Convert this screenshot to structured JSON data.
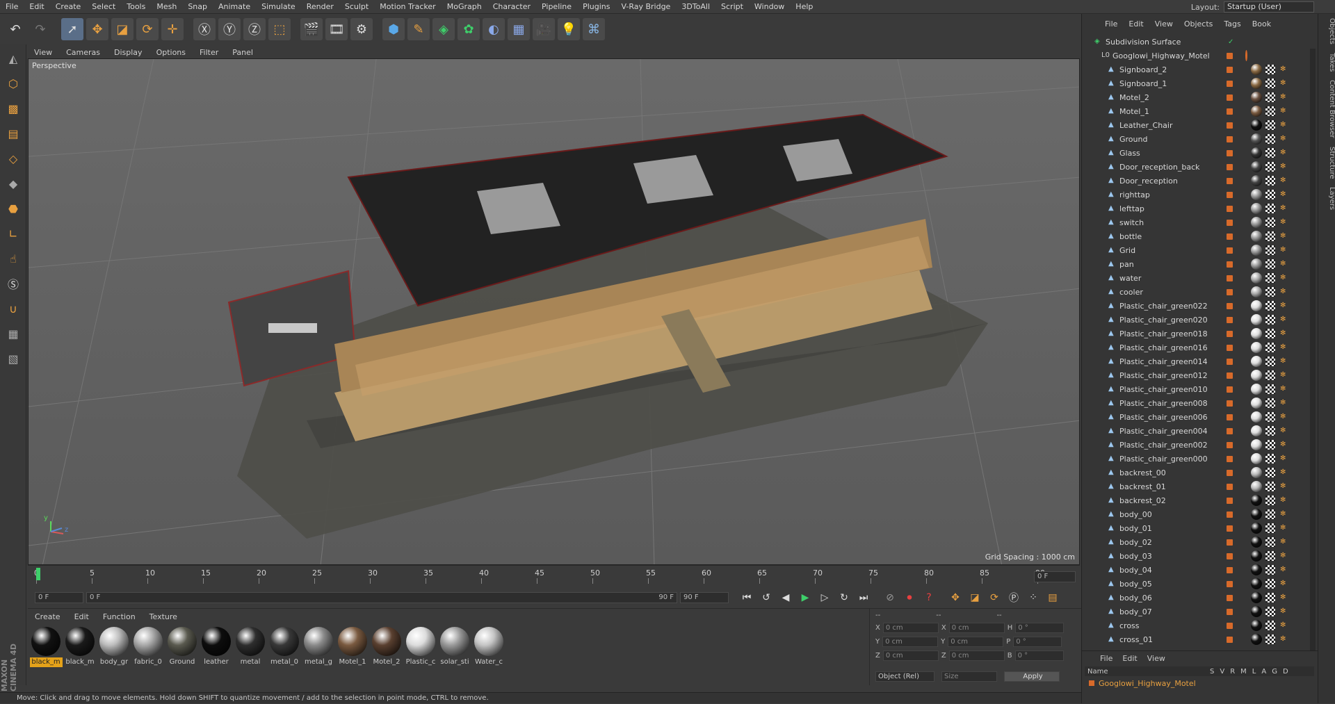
{
  "menubar": {
    "items": [
      "File",
      "Edit",
      "Create",
      "Select",
      "Tools",
      "Mesh",
      "Snap",
      "Animate",
      "Simulate",
      "Render",
      "Sculpt",
      "Motion Tracker",
      "MoGraph",
      "Character",
      "Pipeline",
      "Plugins",
      "V-Ray Bridge",
      "3DToAll",
      "Script",
      "Window",
      "Help"
    ],
    "layout_label": "Layout:",
    "layout_value": "Startup (User)"
  },
  "viewport": {
    "menu": [
      "View",
      "Cameras",
      "Display",
      "Options",
      "Filter",
      "Panel"
    ],
    "label": "Perspective",
    "grid_spacing": "Grid Spacing : 1000 cm",
    "axis_y": "y",
    "axis_z": "z"
  },
  "timeline": {
    "ticks": [
      "0",
      "5",
      "10",
      "15",
      "20",
      "25",
      "30",
      "35",
      "40",
      "45",
      "50",
      "55",
      "60",
      "65",
      "70",
      "75",
      "80",
      "85",
      "90"
    ],
    "current_frame": "0 F",
    "start_field": "0 F",
    "range_start": "0 F",
    "range_end": "90 F",
    "end_field": "90 F",
    "end_field2": "0 F"
  },
  "materials": {
    "menu": [
      "Create",
      "Edit",
      "Function",
      "Texture"
    ],
    "items": [
      {
        "label": "black_m",
        "color": "#111111",
        "selected": true
      },
      {
        "label": "black_m",
        "color": "#1a1a1a",
        "selected": false
      },
      {
        "label": "body_gr",
        "color": "#bdbdbd",
        "selected": false
      },
      {
        "label": "fabric_0",
        "color": "#a8a8a8",
        "selected": false
      },
      {
        "label": "Ground",
        "color": "#5a5a4f",
        "selected": false
      },
      {
        "label": "leather",
        "color": "#0d0d0d",
        "selected": false
      },
      {
        "label": "metal",
        "color": "#2e2e2e",
        "selected": false
      },
      {
        "label": "metal_0",
        "color": "#383838",
        "selected": false
      },
      {
        "label": "metal_g",
        "color": "#8a8a8a",
        "selected": false
      },
      {
        "label": "Motel_1",
        "color": "#7a5a40",
        "selected": false
      },
      {
        "label": "Motel_2",
        "color": "#5a4030",
        "selected": false
      },
      {
        "label": "Plastic_c",
        "color": "#dcdcdc",
        "selected": false
      },
      {
        "label": "solar_sti",
        "color": "#9a9a9a",
        "selected": false
      },
      {
        "label": "Water_c",
        "color": "#c4c4c4",
        "selected": false
      }
    ]
  },
  "coords": {
    "header1": "--",
    "header2": "--",
    "header3": "--",
    "rows": [
      {
        "a": "X",
        "av": "0 cm",
        "b": "X",
        "bv": "0 cm",
        "c": "H",
        "cv": "0 °"
      },
      {
        "a": "Y",
        "av": "0 cm",
        "b": "Y",
        "bv": "0 cm",
        "c": "P",
        "cv": "0 °"
      },
      {
        "a": "Z",
        "av": "0 cm",
        "b": "Z",
        "bv": "0 cm",
        "c": "B",
        "cv": "0 °"
      }
    ],
    "mode": "Object (Rel)",
    "size": "Size",
    "apply": "Apply"
  },
  "objects": {
    "menu": [
      "File",
      "Edit",
      "View",
      "Objects",
      "Tags",
      "Book"
    ],
    "root": "Subdivision Surface",
    "group": "Googlowi_Highway_Motel",
    "items": [
      {
        "name": "Signboard_2",
        "ball": "#8a6a44"
      },
      {
        "name": "Signboard_1",
        "ball": "#8a6a44"
      },
      {
        "name": "Motel_2",
        "ball": "#6a5040"
      },
      {
        "name": "Motel_1",
        "ball": "#7a5a40"
      },
      {
        "name": "Leather_Chair",
        "ball": "#111111"
      },
      {
        "name": "Ground",
        "ball": "#555555"
      },
      {
        "name": "Glass",
        "ball": "#333333"
      },
      {
        "name": "Door_reception_back",
        "ball": "#444444"
      },
      {
        "name": "Door_reception",
        "ball": "#444444"
      },
      {
        "name": "righttap",
        "ball": "#999999"
      },
      {
        "name": "lefttap",
        "ball": "#999999"
      },
      {
        "name": "switch",
        "ball": "#999999"
      },
      {
        "name": "bottle",
        "ball": "#999999"
      },
      {
        "name": "Grid",
        "ball": "#999999"
      },
      {
        "name": "pan",
        "ball": "#999999"
      },
      {
        "name": "water",
        "ball": "#aaaaaa"
      },
      {
        "name": "cooler",
        "ball": "#aaaaaa"
      },
      {
        "name": "Plastic_chair_green022",
        "ball": "#dddddd"
      },
      {
        "name": "Plastic_chair_green020",
        "ball": "#dddddd"
      },
      {
        "name": "Plastic_chair_green018",
        "ball": "#dddddd"
      },
      {
        "name": "Plastic_chair_green016",
        "ball": "#dddddd"
      },
      {
        "name": "Plastic_chair_green014",
        "ball": "#dddddd"
      },
      {
        "name": "Plastic_chair_green012",
        "ball": "#dddddd"
      },
      {
        "name": "Plastic_chair_green010",
        "ball": "#dddddd"
      },
      {
        "name": "Plastic_chair_green008",
        "ball": "#dddddd"
      },
      {
        "name": "Plastic_chair_green006",
        "ball": "#dddddd"
      },
      {
        "name": "Plastic_chair_green004",
        "ball": "#dddddd"
      },
      {
        "name": "Plastic_chair_green002",
        "ball": "#dddddd"
      },
      {
        "name": "Plastic_chair_green000",
        "ball": "#dddddd"
      },
      {
        "name": "backrest_00",
        "ball": "#bbbbbb"
      },
      {
        "name": "backrest_01",
        "ball": "#bbbbbb"
      },
      {
        "name": "backrest_02",
        "ball": "#111111"
      },
      {
        "name": "body_00",
        "ball": "#111111"
      },
      {
        "name": "body_01",
        "ball": "#111111"
      },
      {
        "name": "body_02",
        "ball": "#111111"
      },
      {
        "name": "body_03",
        "ball": "#111111"
      },
      {
        "name": "body_04",
        "ball": "#111111"
      },
      {
        "name": "body_05",
        "ball": "#111111"
      },
      {
        "name": "body_06",
        "ball": "#111111"
      },
      {
        "name": "body_07",
        "ball": "#111111"
      },
      {
        "name": "cross",
        "ball": "#111111"
      },
      {
        "name": "cross_01",
        "ball": "#111111"
      }
    ]
  },
  "layers": {
    "menu": [
      "File",
      "Edit",
      "View"
    ],
    "col_name": "Name",
    "cols": [
      "S",
      "V",
      "R",
      "M",
      "L",
      "A",
      "G",
      "D"
    ],
    "row": "Googlowi_Highway_Motel"
  },
  "right_tabs": [
    "Objects",
    "Takes",
    "Content Browser",
    "Structure",
    "Layers"
  ],
  "status": "Move: Click and drag to move elements. Hold down SHIFT to quantize movement / add to the selection in point mode, CTRL to remove.",
  "brand": "MAXON CINEMA 4D"
}
